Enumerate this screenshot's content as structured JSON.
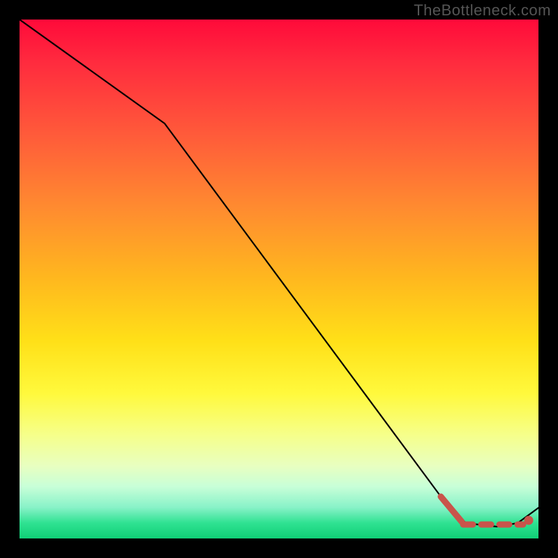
{
  "watermark": "TheBottleneck.com",
  "chart_data": {
    "type": "line",
    "title": "",
    "xlabel": "",
    "ylabel": "",
    "xlim": [
      0,
      100
    ],
    "ylim": [
      0,
      100
    ],
    "series": [
      {
        "name": "main-curve",
        "style": "solid-black",
        "x": [
          0,
          28,
          82,
          86,
          92,
          96,
          100
        ],
        "values": [
          100,
          80,
          7,
          3,
          2,
          3,
          6
        ]
      },
      {
        "name": "highlighted-range",
        "style": "dashed-red",
        "x": [
          82,
          86,
          88,
          90,
          92,
          94,
          96,
          98
        ],
        "values": [
          7,
          2.5,
          2.3,
          2.3,
          2.3,
          2.3,
          2.4,
          3
        ]
      }
    ],
    "markers": [
      {
        "name": "end-point",
        "x": 98,
        "y": 3
      }
    ],
    "background": "vertical-heat-gradient"
  }
}
